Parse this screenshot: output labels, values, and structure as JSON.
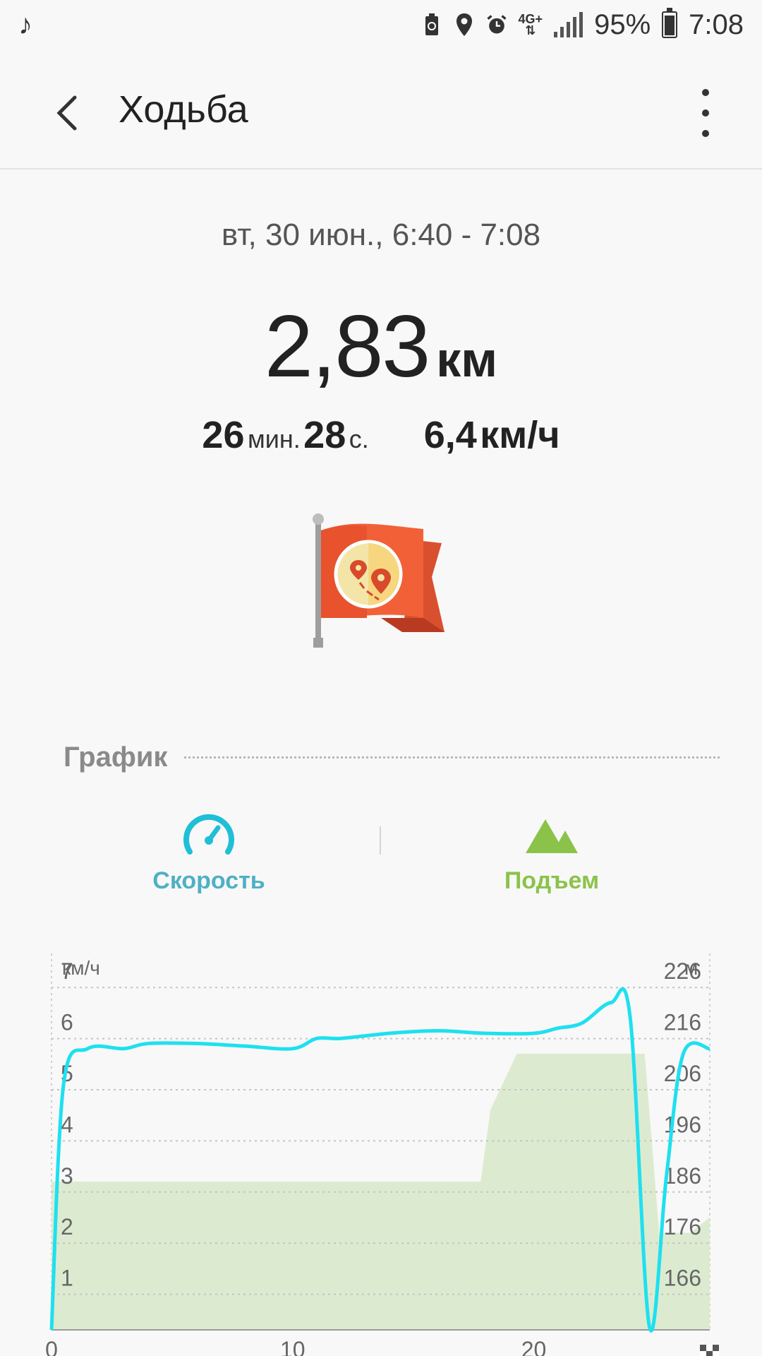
{
  "status_bar": {
    "battery_percent": "95%",
    "time": "7:08",
    "network": "4G+"
  },
  "app_bar": {
    "title": "Ходьба",
    "back_icon": "chevron-left-icon",
    "menu_icon": "more-vert-icon"
  },
  "summary": {
    "date_range": "вт, 30 июн., 6:40 - 7:08",
    "distance_value": "2,83",
    "distance_unit": "км",
    "duration_min_value": "26",
    "duration_min_unit": "мин.",
    "duration_sec_value": "28",
    "duration_sec_unit": "с.",
    "speed_value": "6,4",
    "speed_unit": "км/ч"
  },
  "graph_section": {
    "title": "График",
    "tabs": [
      {
        "label": "Скорость",
        "icon": "speedometer-icon",
        "color": "#4fb0c6"
      },
      {
        "label": "Подъем",
        "icon": "mountain-icon",
        "color": "#8bc34a"
      }
    ]
  },
  "colors": {
    "speed_line": "#1ee0f0",
    "elevation_fill": "#dcebd0"
  },
  "chart_data": {
    "type": "line",
    "left_axis_unit": "км/ч",
    "right_axis_unit": "м",
    "left_ticks": [
      "7",
      "6",
      "5",
      "4",
      "3",
      "2",
      "1"
    ],
    "right_ticks": [
      "226",
      "216",
      "206",
      "196",
      "186",
      "176",
      "166"
    ],
    "x_ticks": [
      "0",
      "10",
      "20"
    ],
    "xlim": [
      0,
      27.3
    ],
    "ylim_speed": [
      0,
      7.5
    ],
    "ylim_elevation": [
      156,
      231
    ],
    "series": [
      {
        "type": "line",
        "x": [
          0,
          0.5,
          1.5,
          3,
          4,
          6,
          8,
          10,
          11,
          12,
          14,
          16,
          18,
          20,
          21,
          22,
          23.2,
          24,
          24.8,
          25.5,
          26.2,
          27.3
        ],
        "values": [
          0,
          4.8,
          5.5,
          5.5,
          5.6,
          5.6,
          5.55,
          5.5,
          5.7,
          5.7,
          5.8,
          5.85,
          5.8,
          5.8,
          5.9,
          6.0,
          6.4,
          6.1,
          0.05,
          3.0,
          5.4,
          5.5
        ]
      },
      {
        "type": "area",
        "x": [
          0,
          1,
          10,
          17.8,
          18.2,
          19.3,
          24.6,
          25.2,
          26.5,
          27.3
        ],
        "values": [
          185,
          185,
          185,
          185,
          199,
          210,
          210,
          175,
          175,
          178
        ]
      }
    ]
  }
}
